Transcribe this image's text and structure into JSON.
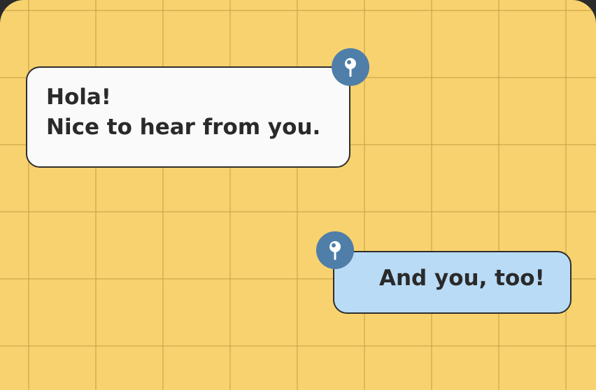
{
  "chat": {
    "messages": [
      {
        "lines": [
          "Hola!",
          "Nice to hear from you."
        ],
        "icon": "pin-icon"
      },
      {
        "lines": [
          "And you, too!"
        ],
        "icon": "pin-icon"
      }
    ]
  },
  "colors": {
    "background": "#f8d26e",
    "grid": "#c8a046",
    "incoming_bubble": "#fafafa",
    "outgoing_bubble": "#b9dbf6",
    "pin_badge": "#4f7ea9",
    "text": "#2a2a2a"
  }
}
